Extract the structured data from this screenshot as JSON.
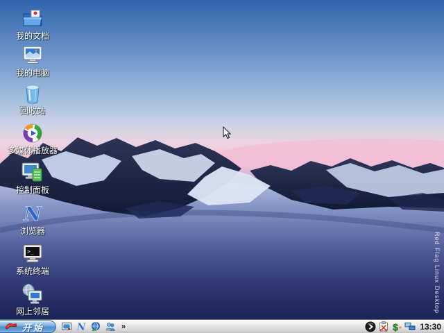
{
  "wallpaper": {
    "watermark": "Red Flag Linux Desktop",
    "description": "snow-covered crater mountains at twilight with pink horizon glow",
    "colors": {
      "sky_top": "#3263ac",
      "horizon_pink": "#f3c6d9",
      "mountain_rock": "#16203e",
      "snow_basin": "#3a4688"
    }
  },
  "desktop": {
    "icons": [
      {
        "id": "my-documents",
        "label": "我的文档"
      },
      {
        "id": "my-computer",
        "label": "我的电脑"
      },
      {
        "id": "recycle-bin",
        "label": "回收站"
      },
      {
        "id": "media-player",
        "label": "多媒体播放器"
      },
      {
        "id": "control-panel",
        "label": "控制面板"
      },
      {
        "id": "browser",
        "label": "浏览器"
      },
      {
        "id": "terminal",
        "label": "系统终端"
      },
      {
        "id": "network-neighborhood",
        "label": "网上邻居"
      }
    ]
  },
  "taskbar": {
    "start_label": "开始",
    "overflow_chevron": "»",
    "quick_launch": [
      {
        "id": "show-desktop"
      },
      {
        "id": "browser"
      },
      {
        "id": "internet-globe"
      },
      {
        "id": "user-manager"
      }
    ],
    "tray": {
      "clock": "13:30"
    }
  }
}
